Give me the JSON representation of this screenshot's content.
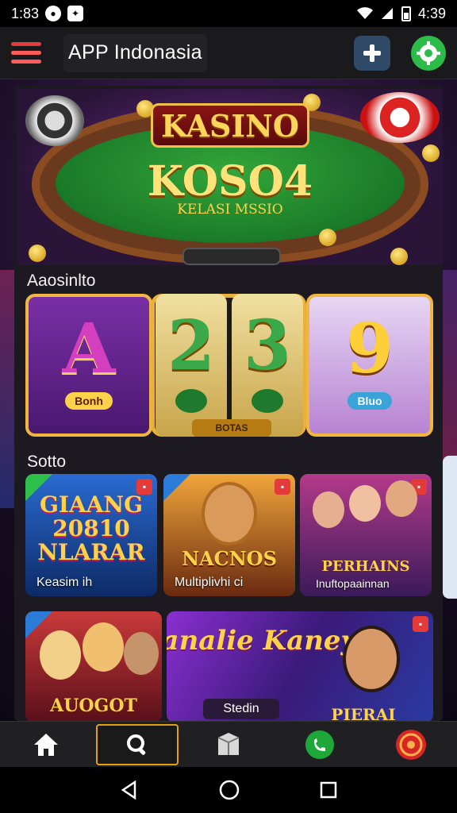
{
  "status_bar": {
    "time": "1:83",
    "clock_right": "4:39",
    "icons": [
      "circle-notification-icon",
      "app-notification-icon",
      "wifi-icon",
      "signal-icon",
      "battery-icon"
    ]
  },
  "app_bar": {
    "title": "APP Indonasia",
    "menu_icon": "hamburger-icon",
    "action_icon": "plus-icon",
    "settings_icon": "gear-icon"
  },
  "banner": {
    "sign": "KASINO",
    "title": "KOSO4",
    "subtitle": "KELASI MSSIO"
  },
  "section_slots": {
    "label": "Aaosinlto"
  },
  "reels": [
    {
      "symbol": "A",
      "tag": "Bonh"
    },
    {
      "symbol": "2",
      "tag": ""
    },
    {
      "symbol": "3",
      "tag": ""
    },
    {
      "symbol": "9",
      "tag": "Bluo"
    }
  ],
  "reel_base_label": "BOTAS",
  "section_games": {
    "label": "Sotto"
  },
  "tiles": [
    {
      "title": "GIAANG 20810 NLARAR",
      "caption": "Keasim ih"
    },
    {
      "title": "NACNOS",
      "caption": "Multiplivhi ci"
    },
    {
      "title": "PERHAINS",
      "caption": "Inuftopaainnan"
    },
    {
      "title": "AUOGOT",
      "caption": ""
    },
    {
      "title": "Manalie Kaneyes",
      "caption": "Stedin"
    },
    {
      "title": "PIERAI",
      "caption": ""
    }
  ],
  "colors": {
    "accent_gold": "#f0b640",
    "nav_active": "#e3a017",
    "gear_green": "#2dbb4a",
    "plus_blue": "#2f4a66"
  },
  "bottom_nav": [
    {
      "icon": "home-icon"
    },
    {
      "icon": "search-icon"
    },
    {
      "icon": "box-icon"
    },
    {
      "icon": "phone-icon"
    },
    {
      "icon": "target-icon"
    }
  ],
  "system_nav": [
    {
      "icon": "back-icon"
    },
    {
      "icon": "home-circle-icon"
    },
    {
      "icon": "recents-icon"
    }
  ]
}
